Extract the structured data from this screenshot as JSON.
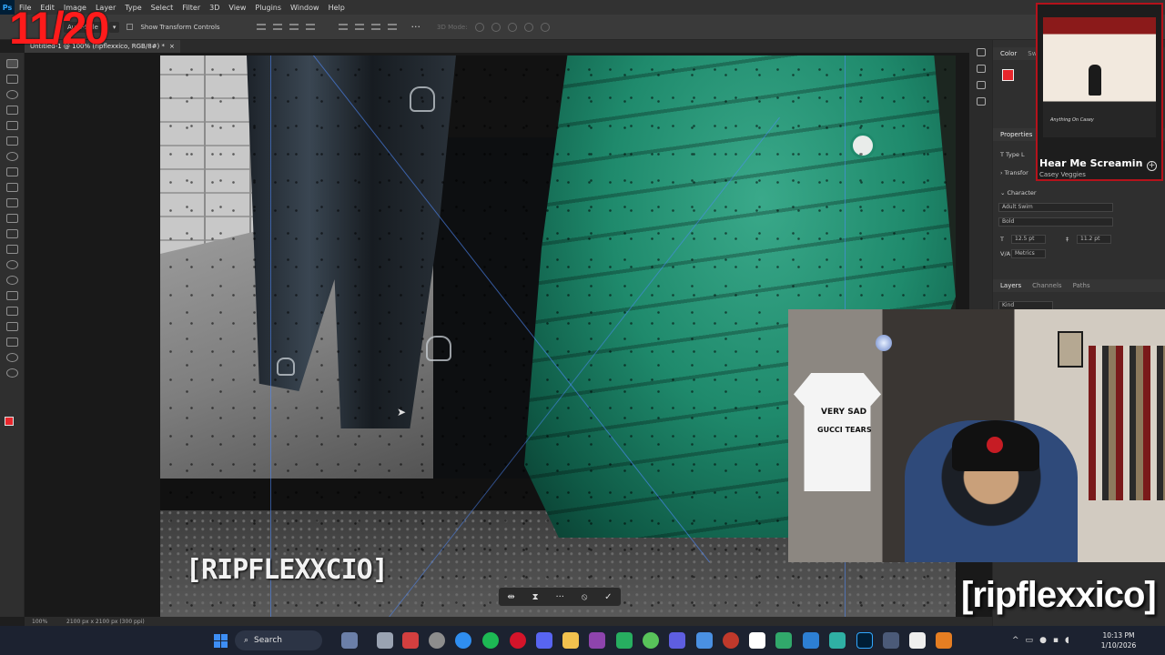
{
  "menubar": {
    "app_icon": "Ps",
    "items": [
      "File",
      "Edit",
      "Image",
      "Layer",
      "Type",
      "Select",
      "Filter",
      "3D",
      "View",
      "Plugins",
      "Window",
      "Help"
    ]
  },
  "optionsbar": {
    "auto_select": "Auto-Sele",
    "show_transform_label": "Show Transform Controls",
    "more": "···",
    "mode_3d": "3D Mode:"
  },
  "document_tab": {
    "title": "Untitled-1 @ 100% (ripflexxico, RGB/8#) *",
    "close": "×"
  },
  "canvas": {
    "watermark_left": "[RIPFLEXXCIO]"
  },
  "context_taskbar": {
    "icons": [
      "flip-icon",
      "transform-icon",
      "more-icon",
      "cancel-icon",
      "commit-icon"
    ],
    "more": "···",
    "commit": "✓",
    "cancel": "⦸"
  },
  "statusbar": {
    "zoom": "100%",
    "doc_info": "2100 px x 2100 px (300 ppi)"
  },
  "right_panel": {
    "color_tab": "Color",
    "swatches_tab": "Swa",
    "properties_title": "Properties",
    "type_layer": "Type L",
    "transform_label": "Transfor",
    "character_label": "Character",
    "font_family": "Adult Swim",
    "font_style": "Bold",
    "font_size": "12.5 pt",
    "leading": "11.2 pt",
    "tracking_label": "V/A",
    "tracking": "Metrics",
    "layers_tabs": [
      "Layers",
      "Channels",
      "Paths"
    ],
    "layers_filter": "Kind"
  },
  "now_playing": {
    "title": "Hear Me Screamin",
    "artist": "Casey Veggies",
    "art_caption": "Anything On Casey",
    "add_icon": "plus-circle-icon"
  },
  "webcam": {
    "shirt_line1": "VERY SAD",
    "shirt_line2": "GUCCI TEARS"
  },
  "stream_overlay": {
    "counter": "11/20",
    "watermark_right": "[ripflexxico]"
  },
  "taskbar": {
    "search_label": "Search",
    "time": "10:13 PM",
    "date": "1/10/2026"
  },
  "colors": {
    "foreground": "#e8262c",
    "background": "#ffffff",
    "accent_red": "#ff1b1b",
    "jacket_green": "#1f8a6c"
  }
}
